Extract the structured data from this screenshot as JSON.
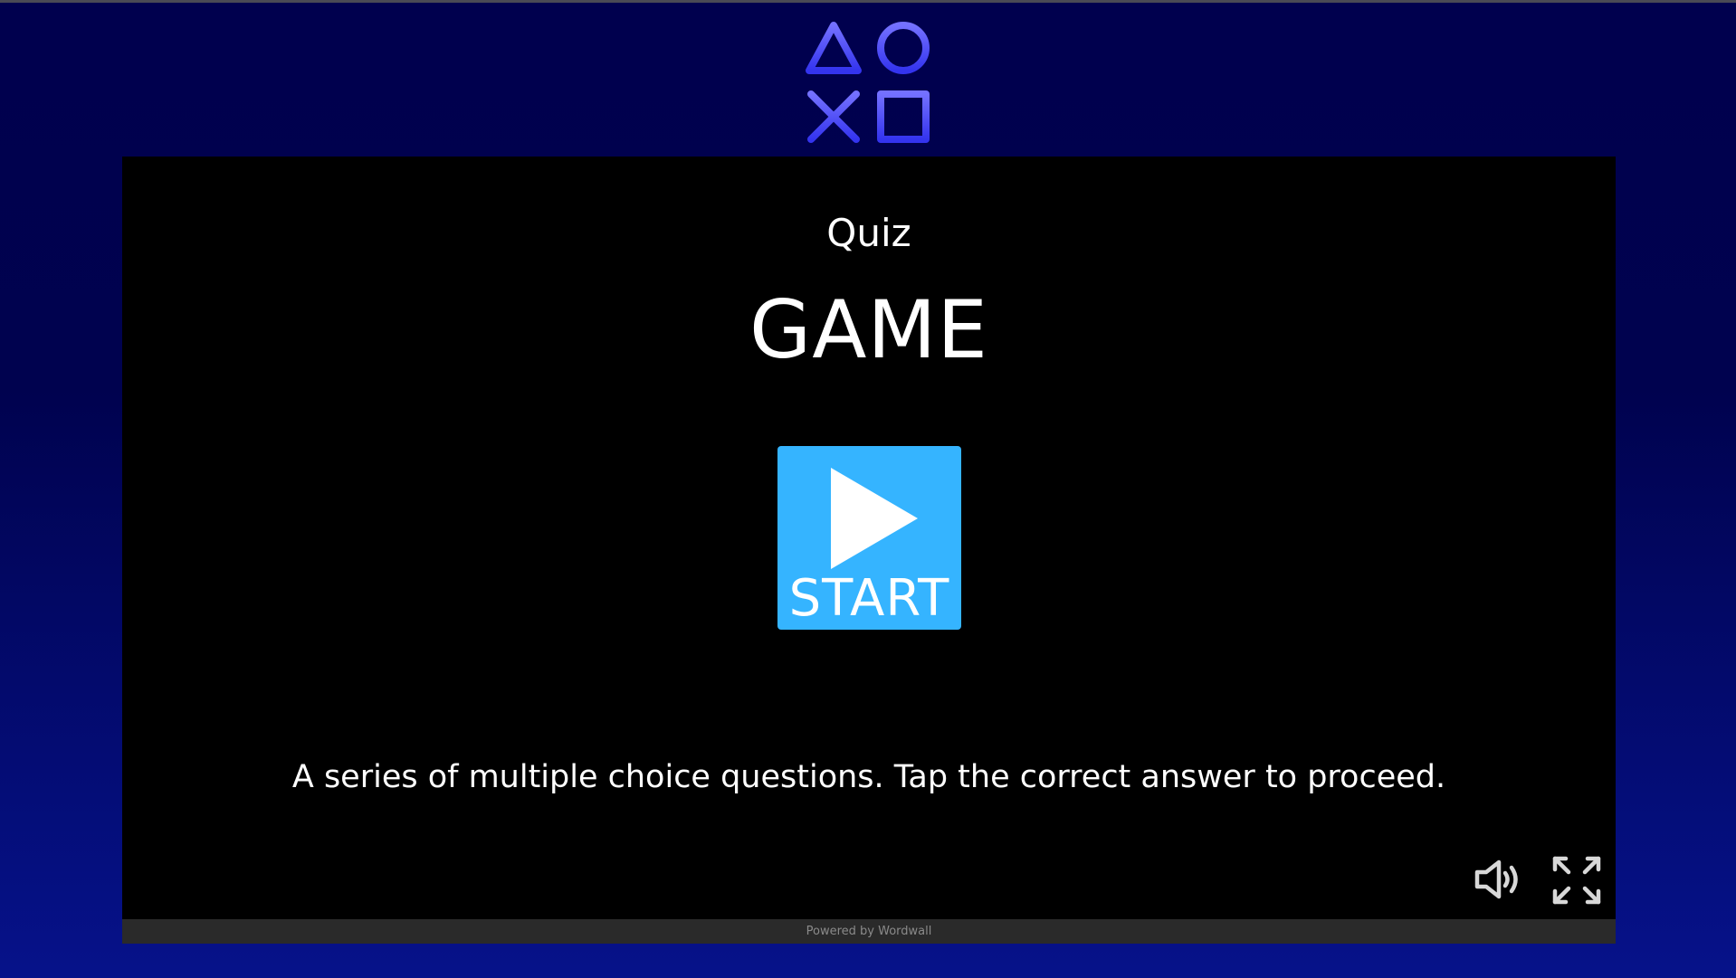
{
  "logo": {
    "icon": "playstation-shapes-icon",
    "colors": [
      "#6f6cff",
      "#3a3af0"
    ]
  },
  "game": {
    "subtitle": "Quiz",
    "title": "GAME",
    "start_label": "START",
    "description": "A series of multiple choice questions. Tap the correct answer to proceed."
  },
  "controls": {
    "sound_icon": "speaker-icon",
    "fullscreen_icon": "fullscreen-icon"
  },
  "footer": {
    "text": "Powered by Wordwall"
  },
  "colors": {
    "background": "#00004e",
    "stage": "#000000",
    "start_button": "#35b4ff"
  }
}
